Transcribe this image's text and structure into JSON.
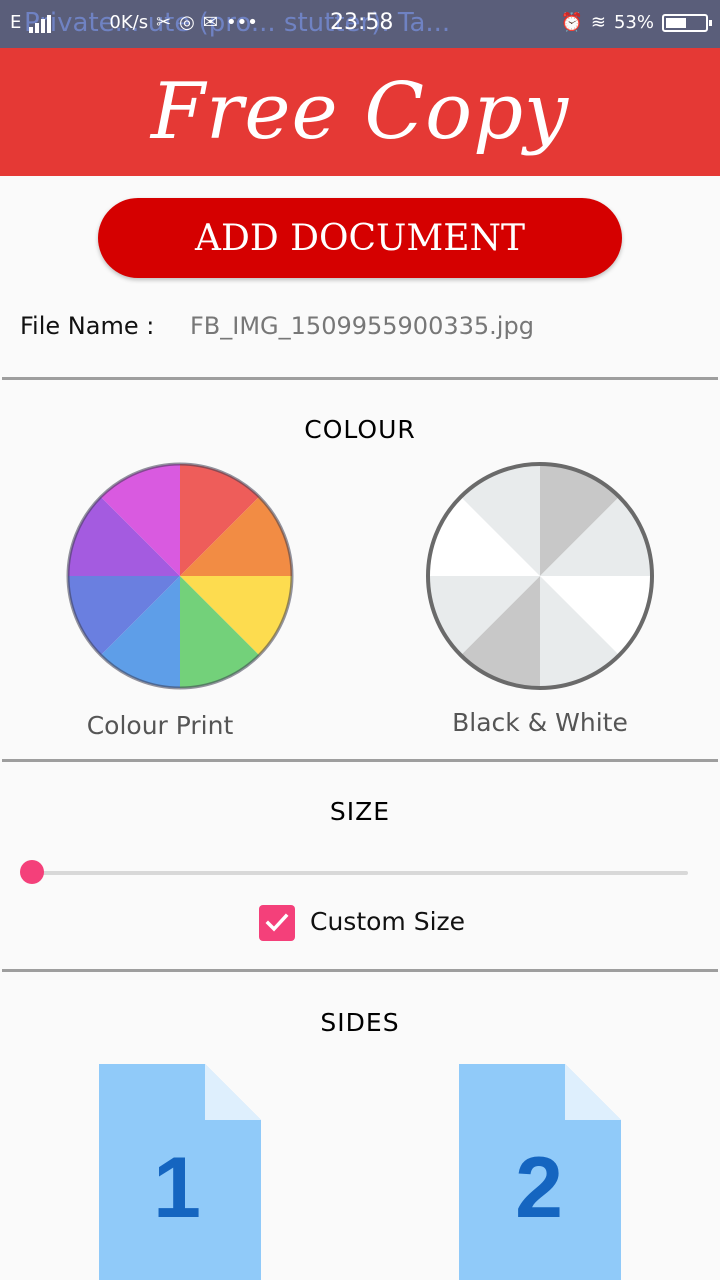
{
  "status_bar": {
    "ghost_text": "Private... ute (pro... stutter). Ta...",
    "carrier": "E",
    "speed": "0K/s",
    "time": "23:58",
    "battery": "53%",
    "battery_level": 0.53
  },
  "header": {
    "title": "Free Copy"
  },
  "add_document": {
    "label": "ADD DOCUMENT"
  },
  "file": {
    "label": "File Name :",
    "value": "FB_IMG_1509955900335.jpg"
  },
  "colour": {
    "title": "COLOUR",
    "options": [
      {
        "label": "Colour Print",
        "icon": "color-wheel-icon"
      },
      {
        "label": "Black & White",
        "icon": "grayscale-wheel-icon"
      }
    ]
  },
  "size": {
    "title": "SIZE",
    "slider_value": 0,
    "custom_size_label": "Custom Size",
    "custom_size_checked": true
  },
  "sides": {
    "title": "SIDES",
    "options": [
      {
        "label": "1",
        "icon": "one-sided-document-icon"
      },
      {
        "label": "2",
        "icon": "two-sided-document-icon"
      }
    ]
  },
  "colors": {
    "header": "#e53935",
    "button": "#d50000",
    "accent": "#f4407a",
    "document": "#90caf9",
    "document_text": "#1565c0"
  }
}
